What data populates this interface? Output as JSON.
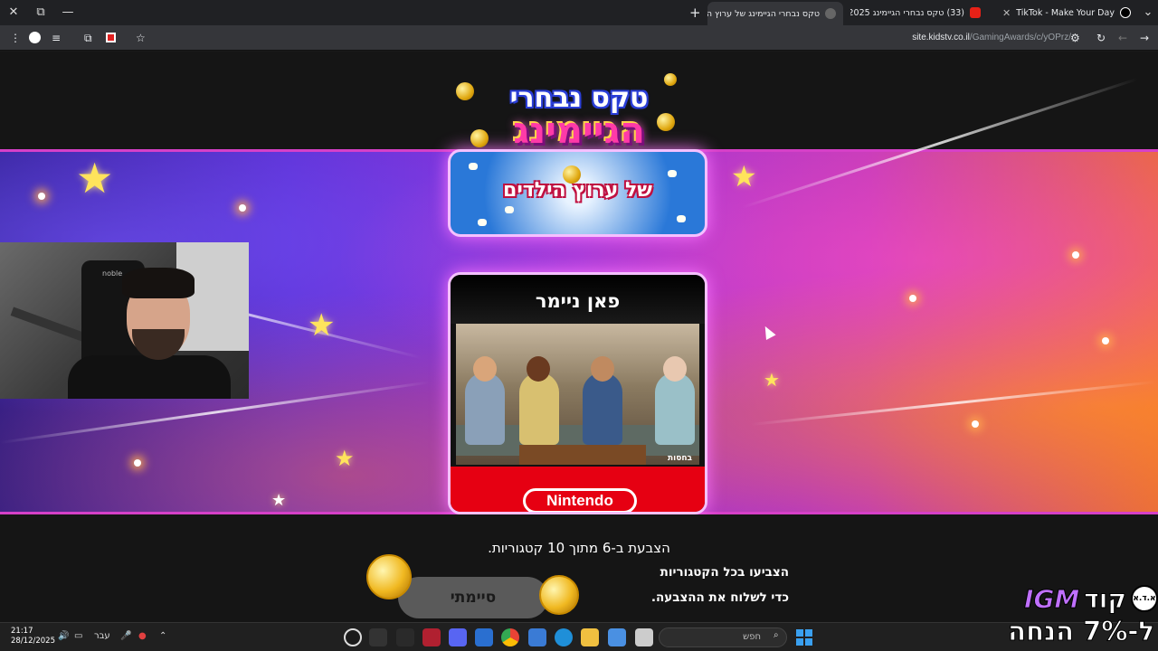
{
  "window": {
    "close_glyph": "✕",
    "restore_glyph": "⧉",
    "minimize_glyph": "—"
  },
  "tabs": [
    {
      "title": "TikTok - Make Your Day",
      "favicon": "tiktok-icon",
      "active": false
    },
    {
      "title": "(33) טקס נבחרי הגיימינג 2025",
      "favicon": "youtube-icon",
      "active": false
    },
    {
      "title": "טקס נבחרי הגיימינג של ערוץ ה",
      "favicon": "site-icon",
      "active": true
    }
  ],
  "toolbar": {
    "url_host": "site.kidstv.co.il",
    "url_path": "/GamingAwards/c/yOPrz/"
  },
  "logo": {
    "line1": "טקס נבחרי",
    "line2": "הגיימינג"
  },
  "top_card": {
    "text": "של ערוץ הילדים"
  },
  "nominee_card": {
    "title": "פאן ניימר",
    "nominee_label": "בחסות",
    "brand": "Nintendo"
  },
  "footer": {
    "vote_count": "הצבעת ב-6 מתוך 10 קטגוריות.",
    "done_button": "סיימתי",
    "hint_line1": "הצביעו בכל הקטגוריות",
    "hint_line2": "כדי לשלוח את ההצבעה."
  },
  "webcam": {
    "chair_brand": "noble"
  },
  "taskbar": {
    "time": "21:17",
    "date": "28/12/2025",
    "language": "עבר",
    "search_placeholder": "חפש"
  },
  "promo": {
    "line1_word": "קוד",
    "line1_code": "IGM",
    "badge": "א.ד.א",
    "line2": "ל-7% הנחה"
  },
  "colors": {
    "accent_pink": "#d640c8",
    "nintendo_red": "#e60012",
    "taskbar": "#202020"
  }
}
